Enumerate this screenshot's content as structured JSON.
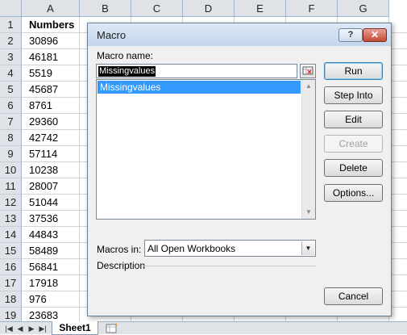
{
  "spreadsheet": {
    "columns": [
      "A",
      "B",
      "C",
      "D",
      "E",
      "F",
      "G"
    ],
    "rows": [
      "1",
      "2",
      "3",
      "4",
      "5",
      "6",
      "7",
      "8",
      "9",
      "10",
      "11",
      "12",
      "13",
      "14",
      "15",
      "16",
      "17",
      "18",
      "19"
    ],
    "column_a": [
      "Numbers",
      "30896",
      "46181",
      "5519",
      "45687",
      "8761",
      "29360",
      "42742",
      "57114",
      "10238",
      "28007",
      "51044",
      "37536",
      "44843",
      "58489",
      "56841",
      "17918",
      "976",
      "23683"
    ],
    "sheet_tab": "Sheet1"
  },
  "dialog": {
    "title": "Macro",
    "help_label": "?",
    "close_label": "✕",
    "macro_name_label": "Macro name:",
    "macro_name_value": "Missingvalues",
    "macro_list": [
      "Missingvalues"
    ],
    "buttons": {
      "run": "Run",
      "step_into": "Step Into",
      "edit": "Edit",
      "create": "Create",
      "delete": "Delete",
      "options": "Options...",
      "cancel": "Cancel"
    },
    "macros_in_label": "Macros in:",
    "macros_in_value": "All Open Workbooks",
    "description_label": "Description"
  }
}
